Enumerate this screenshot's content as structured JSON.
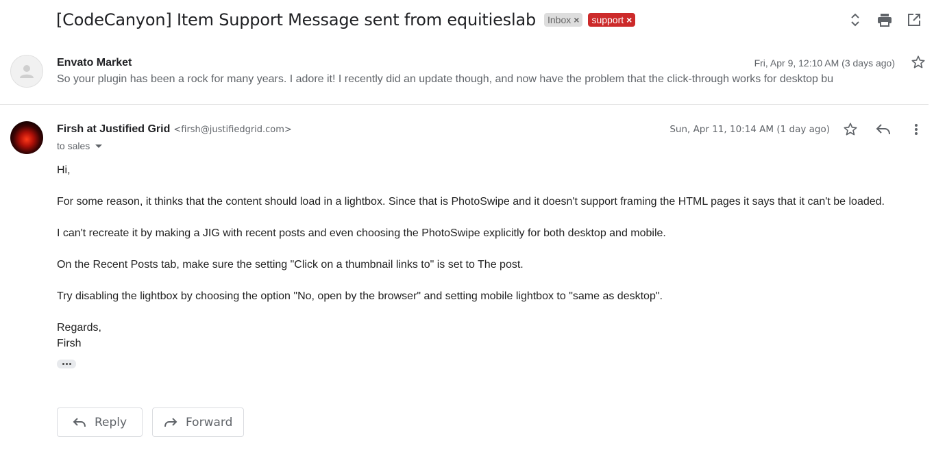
{
  "thread": {
    "subject": "[CodeCanyon] Item Support Message sent from equitieslab",
    "labels": [
      {
        "text": "Inbox",
        "bg": "#dddddd",
        "fg": "#666666"
      },
      {
        "text": "support",
        "bg": "#cc2a2a",
        "fg": "#ffffff"
      }
    ],
    "remove_glyph": "×"
  },
  "toolbar_icons": [
    "expand-collapse-icon",
    "print-icon",
    "open-new-window-icon"
  ],
  "message1": {
    "sender": "Envato Market",
    "date": "Fri, Apr 9, 12:10 AM (3 days ago)",
    "snippet": "So your plugin has been a rock for many years. I adore it! I recently did an update though, and now have the problem that the click-through works for desktop bu"
  },
  "message2": {
    "sender": "Firsh at Justified Grid",
    "email": "<firsh@justifiedgrid.com>",
    "date": "Sun, Apr 11, 10:14 AM (1 day ago)",
    "to": "to sales",
    "body": {
      "greeting": "Hi,",
      "p1": "For some reason, it thinks that the content should load in a lightbox. Since that is PhotoSwipe and it doesn't support framing the HTML pages it says that it can't be loaded.",
      "p2": "I can't recreate it by making a JIG with recent posts and even choosing the PhotoSwipe explicitly for both desktop and mobile.",
      "p3": "On the Recent Posts tab, make sure the setting \"Click on a thumbnail links to\" is set to The post.",
      "p4": "Try disabling the lightbox by choosing the option \"No, open by the browser\" and setting mobile lightbox to \"same as desktop\".",
      "closing": "Regards,",
      "signature": "Firsh"
    }
  },
  "buttons": {
    "reply": "Reply",
    "forward": "Forward"
  },
  "colors": {
    "accent_support": "#cc2a2a",
    "text_secondary": "#5f6368"
  }
}
